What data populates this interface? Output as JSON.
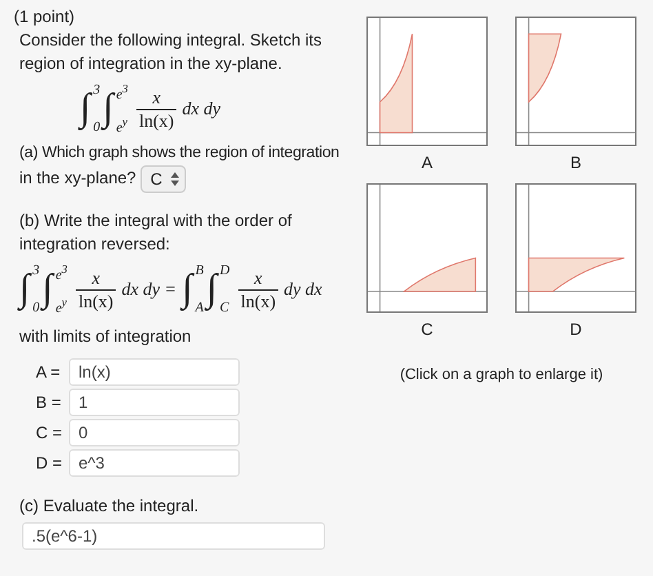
{
  "header": "(1 point)",
  "intro": "Consider the following integral. Sketch its region of integration in the xy-plane.",
  "integral": [
    {
      "kind": "integral",
      "sign": "∫",
      "upper": "3",
      "lower": "0"
    },
    {
      "kind": "integral",
      "sign": "∫",
      "upper": "e$^{3}$",
      "lower": "e$^{y}$"
    },
    {
      "kind": "fraction",
      "numerator": "x",
      "denominator": "ln(x)"
    },
    {
      "kind": "text",
      "text": "dx dy"
    }
  ],
  "part_a": {
    "question": [
      "(a) Which graph shows the region of integration",
      "in the xy-plane?"
    ],
    "answer": "C"
  },
  "part_b": {
    "question": "(b) Write the integral with the order of integration reversed:",
    "formula": [
      {
        "kind": "integral",
        "sign": "∫",
        "upper": "3",
        "lower": "0"
      },
      {
        "kind": "integral",
        "sign": "∫",
        "upper": "e$^{3}$",
        "lower": "e$^{y}$"
      },
      {
        "kind": "fraction",
        "numerator": "x",
        "denominator": "ln(x)"
      },
      {
        "kind": "text",
        "text": "dx dy ="
      },
      {
        "kind": "integral",
        "sign": "∫",
        "upper": "B",
        "lower": "A"
      },
      {
        "kind": "integral",
        "sign": "∫",
        "upper": "D",
        "lower": "C"
      },
      {
        "kind": "fraction",
        "numerator": "x",
        "denominator": "ln(x)"
      },
      {
        "kind": "text",
        "text": "dy dx"
      }
    ],
    "note": "with limits of integration",
    "limits": [
      {
        "label": "A =",
        "value": "ln(x)"
      },
      {
        "label": "B =",
        "value": "1"
      },
      {
        "label": "C =",
        "value": "0"
      },
      {
        "label": "D =",
        "value": "e^3"
      }
    ]
  },
  "part_c": {
    "question": "(c) Evaluate the integral.",
    "answer": ".5(e^6-1)"
  },
  "graphs": [
    {
      "label": "A",
      "kind": "tallbelow"
    },
    {
      "label": "B",
      "kind": "tallabove"
    },
    {
      "label": "C",
      "kind": "widebelow"
    },
    {
      "label": "D",
      "kind": "wideabove"
    }
  ],
  "graph_caption": "(Click on a graph to enlarge it)"
}
